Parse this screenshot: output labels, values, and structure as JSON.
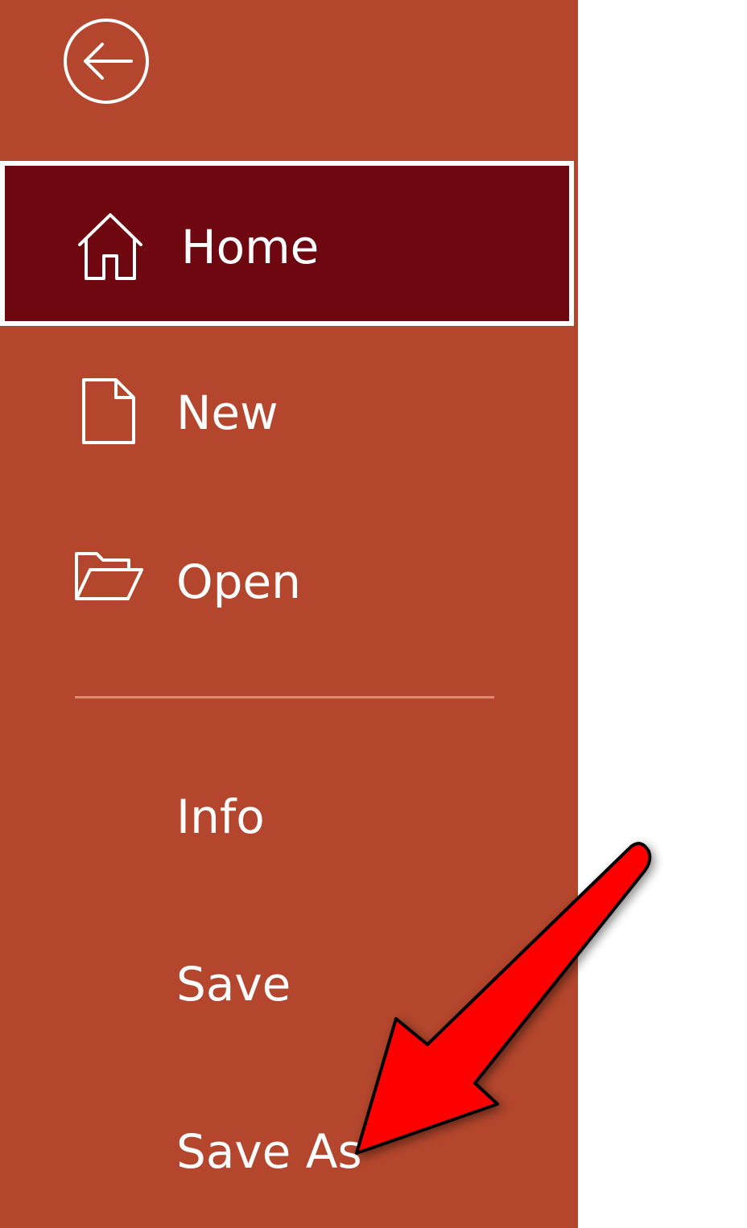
{
  "backstage": {
    "background_color": "#b3462c",
    "selected_color": "#6f0711",
    "back_button": {
      "icon": "arrow-left-circle-icon"
    },
    "items": [
      {
        "label": "Home",
        "icon": "home-icon",
        "selected": true
      },
      {
        "label": "New",
        "icon": "new-document-icon",
        "selected": false
      },
      {
        "label": "Open",
        "icon": "open-folder-icon",
        "selected": false
      },
      {
        "label": "Info",
        "selected": false
      },
      {
        "label": "Save",
        "selected": false
      },
      {
        "label": "Save As",
        "selected": false
      }
    ]
  },
  "annotation": {
    "type": "red-arrow",
    "color": "#ff0000",
    "points_to": "Save As"
  }
}
